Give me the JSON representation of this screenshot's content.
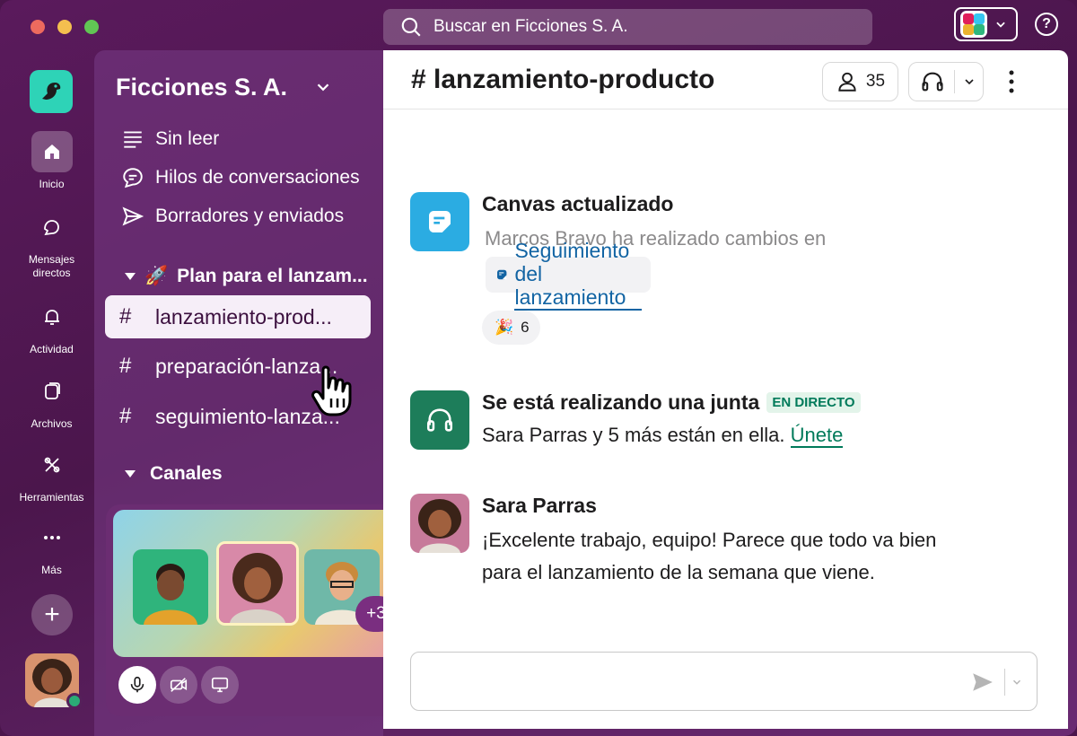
{
  "window": {
    "search_placeholder": "Buscar en Ficciones S. A."
  },
  "rail": {
    "items": [
      {
        "label": "Inicio",
        "icon": "home-icon"
      },
      {
        "label": "Mensajes directos",
        "icon": "chat-bubbles-icon"
      },
      {
        "label": "Actividad",
        "icon": "bell-icon"
      },
      {
        "label": "Archivos",
        "icon": "files-icon"
      },
      {
        "label": "Herramientas",
        "icon": "tools-icon"
      },
      {
        "label": "Más",
        "icon": "more-icon"
      }
    ]
  },
  "sidebar": {
    "workspace_name": "Ficciones S. A.",
    "nav": [
      {
        "label": "Sin leer",
        "icon": "unread-icon"
      },
      {
        "label": "Hilos de conversaciones",
        "icon": "threads-icon"
      },
      {
        "label": "Borradores y enviados",
        "icon": "send-icon"
      }
    ],
    "section_plan": {
      "emoji": "🚀",
      "label": "Plan para el lanzam..."
    },
    "channels": [
      {
        "label": "lanzamiento-prod...",
        "active": true
      },
      {
        "label": "preparación-lanza...",
        "active": false
      },
      {
        "label": "seguimiento-lanza...",
        "active": false
      }
    ],
    "section_channels": "Canales"
  },
  "huddle": {
    "extra_count": "+3"
  },
  "channel": {
    "title": "# lanzamiento-producto",
    "member_count": "35"
  },
  "messages": {
    "canvas": {
      "title": "Canvas actualizado",
      "text": "Marcos Bravo ha realizado cambios en",
      "link": "Seguimiento del lanzamiento",
      "reaction_emoji": "🎉",
      "reaction_count": "6"
    },
    "huddle": {
      "title": "Se está realizando una junta",
      "badge": "EN DIRECTO",
      "text": "Sara Parras y 5 más están en ella.",
      "link": "Únete"
    },
    "sara": {
      "author": "Sara Parras",
      "line1": "¡Excelente trabajo, equipo! Parece que todo va bien",
      "line2": "para el lanzamiento de la semana que viene."
    }
  },
  "colors": {
    "aubergine": "#4a154b",
    "accent_green": "#007a5a",
    "link_blue": "#1264a3"
  }
}
